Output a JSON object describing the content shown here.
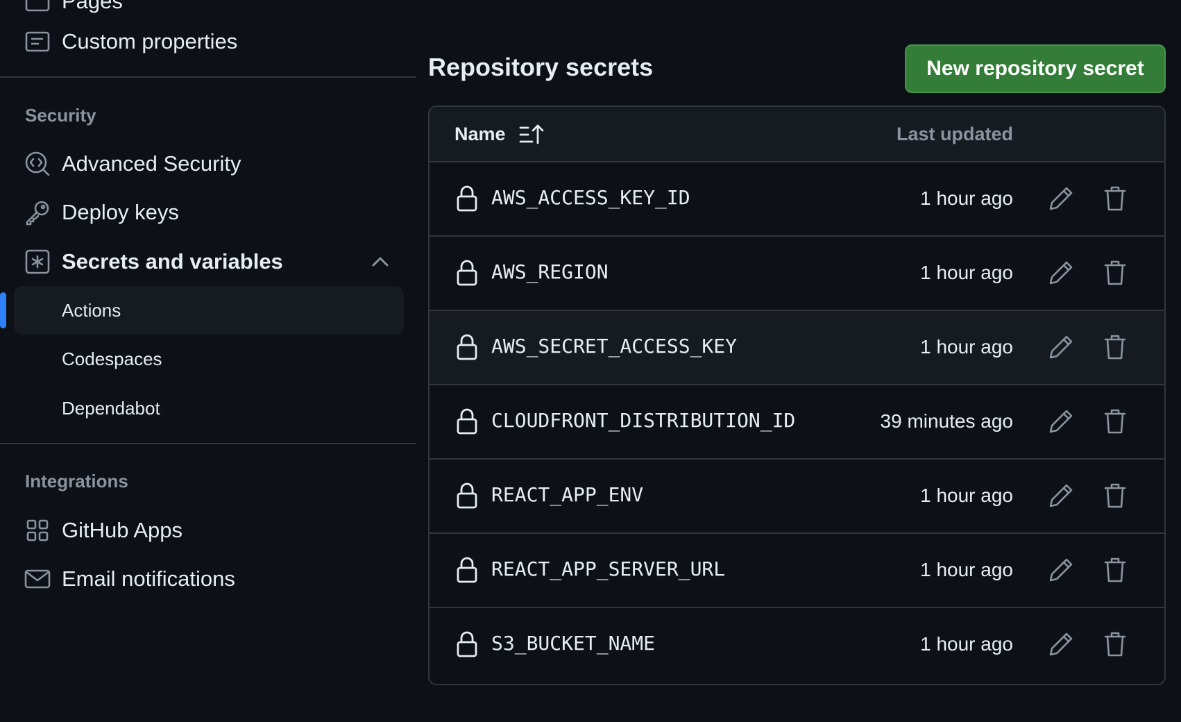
{
  "sidebar": {
    "top_items": [
      {
        "label": "Pages",
        "icon": "browser-icon"
      },
      {
        "label": "Custom properties",
        "icon": "note-icon"
      }
    ],
    "security": {
      "heading": "Security",
      "items": [
        {
          "label": "Advanced Security",
          "icon": "codescan-icon"
        },
        {
          "label": "Deploy keys",
          "icon": "key-icon"
        },
        {
          "label": "Secrets and variables",
          "icon": "key-asterisk-icon",
          "expanded": true
        }
      ],
      "sub_items": [
        {
          "label": "Actions",
          "active": true
        },
        {
          "label": "Codespaces",
          "active": false
        },
        {
          "label": "Dependabot",
          "active": false
        }
      ]
    },
    "integrations": {
      "heading": "Integrations",
      "items": [
        {
          "label": "GitHub Apps",
          "icon": "apps-icon"
        },
        {
          "label": "Email notifications",
          "icon": "mail-icon"
        }
      ]
    }
  },
  "main": {
    "title": "Repository secrets",
    "new_button": "New repository secret",
    "table": {
      "col_name": "Name",
      "col_updated": "Last updated",
      "rows": [
        {
          "name": "AWS_ACCESS_KEY_ID",
          "updated": "1 hour ago"
        },
        {
          "name": "AWS_REGION",
          "updated": "1 hour ago"
        },
        {
          "name": "AWS_SECRET_ACCESS_KEY",
          "updated": "1 hour ago"
        },
        {
          "name": "CLOUDFRONT_DISTRIBUTION_ID",
          "updated": "39 minutes ago"
        },
        {
          "name": "REACT_APP_ENV",
          "updated": "1 hour ago"
        },
        {
          "name": "REACT_APP_SERVER_URL",
          "updated": "1 hour ago"
        },
        {
          "name": "S3_BUCKET_NAME",
          "updated": "1 hour ago"
        }
      ]
    }
  },
  "colors": {
    "background": "#0d1117",
    "accent_blue": "#2f81f7",
    "button_green": "#347d39",
    "border": "#30363d"
  }
}
